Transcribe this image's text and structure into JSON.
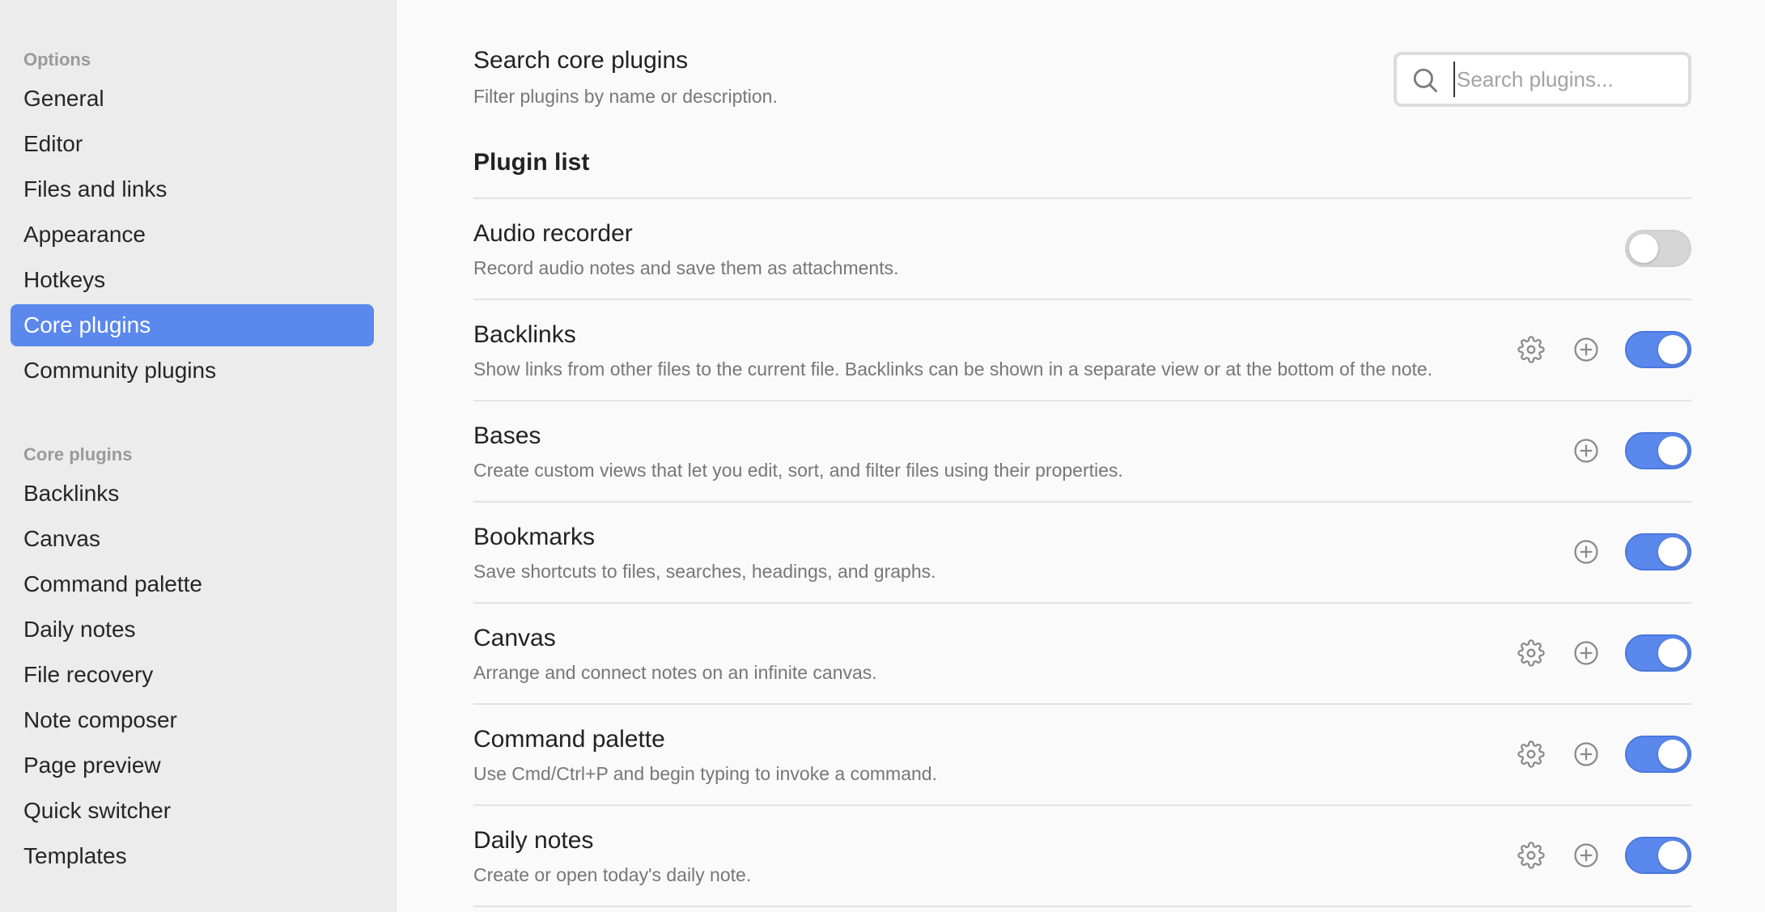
{
  "sidebar": {
    "options_heading": "Options",
    "options": [
      {
        "label": "General",
        "active": false
      },
      {
        "label": "Editor",
        "active": false
      },
      {
        "label": "Files and links",
        "active": false
      },
      {
        "label": "Appearance",
        "active": false
      },
      {
        "label": "Hotkeys",
        "active": false
      },
      {
        "label": "Core plugins",
        "active": true
      },
      {
        "label": "Community plugins",
        "active": false
      }
    ],
    "core_heading": "Core plugins",
    "core_plugins": [
      {
        "label": "Backlinks"
      },
      {
        "label": "Canvas"
      },
      {
        "label": "Command palette"
      },
      {
        "label": "Daily notes"
      },
      {
        "label": "File recovery"
      },
      {
        "label": "Note composer"
      },
      {
        "label": "Page preview"
      },
      {
        "label": "Quick switcher"
      },
      {
        "label": "Templates"
      }
    ]
  },
  "search": {
    "title": "Search core plugins",
    "description": "Filter plugins by name or description.",
    "placeholder": "Search plugins...",
    "value": ""
  },
  "plugin_list": {
    "heading": "Plugin list",
    "plugins": [
      {
        "name": "Audio recorder",
        "description": "Record audio notes and save them as attachments.",
        "has_settings": false,
        "has_add": false,
        "enabled": false
      },
      {
        "name": "Backlinks",
        "description": "Show links from other files to the current file. Backlinks can be shown in a separate view or at the bottom of the note.",
        "has_settings": true,
        "has_add": true,
        "enabled": true
      },
      {
        "name": "Bases",
        "description": "Create custom views that let you edit, sort, and filter files using their properties.",
        "has_settings": false,
        "has_add": true,
        "enabled": true
      },
      {
        "name": "Bookmarks",
        "description": "Save shortcuts to files, searches, headings, and graphs.",
        "has_settings": false,
        "has_add": true,
        "enabled": true
      },
      {
        "name": "Canvas",
        "description": "Arrange and connect notes on an infinite canvas.",
        "has_settings": true,
        "has_add": true,
        "enabled": true
      },
      {
        "name": "Command palette",
        "description": "Use Cmd/Ctrl+P and begin typing to invoke a command.",
        "has_settings": true,
        "has_add": true,
        "enabled": true
      },
      {
        "name": "Daily notes",
        "description": "Create or open today's daily note.",
        "has_settings": true,
        "has_add": true,
        "enabled": true
      }
    ]
  },
  "icons": {
    "search": "search-icon",
    "settings": "gear-icon",
    "add": "plus-circle-icon"
  },
  "colors": {
    "accent": "#5a88ec",
    "toggle_off": "#d6d6d6"
  }
}
